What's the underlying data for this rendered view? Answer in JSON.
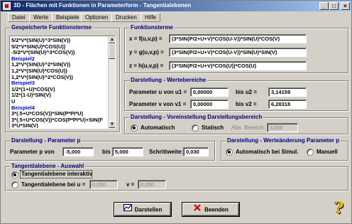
{
  "window": {
    "title": "3D - Flächen mit Funktionen in Parameterform - Tangentialebenen",
    "minimize": "_",
    "maximize": "□",
    "close": "×"
  },
  "menu": [
    "Datei",
    "Werte",
    "Beispiele",
    "Optionen",
    "Drucken",
    "Hilfe"
  ],
  "saved_functions": {
    "title": "Gespeicherte Funktionsterme",
    "lines": [
      {
        "text": "5/2*V*(SIN(U)^3*SIN(V))",
        "header": false
      },
      {
        "text": "5/2*V*SIN(U)*COS(U))",
        "header": false
      },
      {
        "text": "-5/2*V*(SIN(U)^3*COS(V))",
        "header": false
      },
      {
        "text": "Beispiel2",
        "header": true
      },
      {
        "text": "1,2*V*(SIN(U)^2*SIN(V))",
        "header": false
      },
      {
        "text": "1,2*V*(SIN(U)*COS(U))",
        "header": false
      },
      {
        "text": "1,2*V*(SIN(U)^2*COS(V))",
        "header": false
      },
      {
        "text": "Beispiel3",
        "header": true
      },
      {
        "text": "1/2*(1+U)*COS(V)",
        "header": false
      },
      {
        "text": "1/2*(1-U)*SIN(V)",
        "header": false
      },
      {
        "text": "U",
        "header": false
      },
      {
        "text": "Beispiel4",
        "header": true
      },
      {
        "text": "3*(.5+U*COS(V))*SIN(P*PI*U)",
        "header": false
      },
      {
        "text": "3*(.5+U*COS(V))*COS(P*PI*U)+SIN(F",
        "header": false
      },
      {
        "text": "3*U*SIN(V)",
        "header": false
      }
    ]
  },
  "function_terms": {
    "title": "Funktionsterme",
    "x_label": "x = f(u,v,p) =",
    "x_value": "(3*SIN(P/2+U+V)*COS(U-V))*SIN(U)*COS(V)",
    "y_label": "y = g(u,v,p) =",
    "y_value": "(3*SIN(P/2+U+V)*COS(U-V))*SIN(U)*SIN(V)",
    "z_label": "z = h(u,v,p) =",
    "z_value": "(3*SIN(P/2+U+V)*COS(U))*COS(U)"
  },
  "value_range": {
    "title": "Darstellung - Wertebereiche",
    "u_label": "Parameter u von u1 =",
    "u1": "0,00000",
    "u2_label": "bis u2 =",
    "u2": "3,14159",
    "v_label": "Parameter v von v1 =",
    "v1": "0,00000",
    "v2_label": "bis v2 =",
    "v2": "6,28318"
  },
  "display_area": {
    "title": "Darstellung - Voreinstellung Darstellungsbereich",
    "auto_label": "Automatisch",
    "static_label": "Statisch",
    "abs_label": "Abs. Bereich:",
    "abs_value": "3,000",
    "selected": "auto"
  },
  "parameter_p": {
    "title": "Darstellung - Parameter p",
    "from_label": "Parameter p von",
    "from": "-5,000",
    "to_label": "bis",
    "to": "5,000",
    "step_label": "Schrittweite:",
    "step": "0,030"
  },
  "p_change": {
    "title": "Darstellung - Werteänderung Parameter p",
    "auto_label": "Automatisch bei Simul.",
    "manual_label": "Manuell",
    "selected": "auto"
  },
  "tangent": {
    "title": "Tangentialebene - Auswahl",
    "interactive_label": "Tangentialebene interaktiv",
    "at_label": "Tangentialebene bei u =",
    "u_value": "0,000",
    "v_label": "v =",
    "v_value": "0,000",
    "selected": "interactive"
  },
  "buttons": {
    "draw": "Darstellen",
    "exit": "Beenden",
    "help": "?"
  },
  "colors": {
    "title_start": "#0a246a",
    "title_end": "#a6caf0",
    "group_title": "#000080",
    "list_header": "#0000c0"
  }
}
